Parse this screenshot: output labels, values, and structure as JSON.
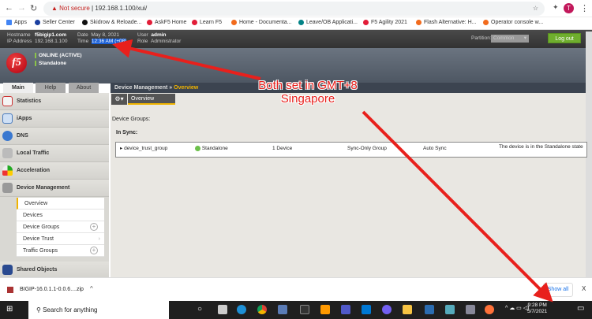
{
  "browser": {
    "security": "Not secure",
    "url": "192.168.1.100/xui/",
    "profile_initial": "T",
    "bookmarks": [
      "Apps",
      "Seller Center",
      "Skidrow & Reloade...",
      "AskF5 Home",
      "Learn F5",
      "Home - Documenta...",
      "Leave/OB Applicati...",
      "F5 Agility 2021",
      "Flash Alternative: H...",
      "Operator console w..."
    ]
  },
  "header": {
    "hostname_label": "Hostname",
    "hostname": "f5bigip1.com",
    "ip_label": "IP Address",
    "ip": "192.168.1.100",
    "date_label": "Date",
    "date": "May 8, 2021",
    "time_label": "Time",
    "time": "12:36 AM (+08)",
    "user_label": "User",
    "user": "admin",
    "role_label": "Role",
    "role": "Administrator",
    "partition_label": "Partition:",
    "partition": "Common",
    "logout": "Log out"
  },
  "status": {
    "online": "ONLINE (ACTIVE)",
    "mode": "Standalone",
    "logo": "f5"
  },
  "tabs": [
    "Main",
    "Help",
    "About"
  ],
  "breadcrumb": {
    "section": "Device Management",
    "sep": "»",
    "current": "Overview"
  },
  "subtab": "Overview",
  "sidebar": {
    "items": [
      "Statistics",
      "iApps",
      "DNS",
      "Local Traffic",
      "Acceleration",
      "Device Management"
    ],
    "subitems": [
      "Overview",
      "Devices",
      "Device Groups",
      "Device Trust",
      "Traffic Groups"
    ],
    "bottom": "Shared Objects"
  },
  "content": {
    "heading": "Device Groups:",
    "sync_label": "In Sync:",
    "row": {
      "name": "device_trust_group",
      "status": "Standalone",
      "devices": "1 Device",
      "type": "Sync-Only Group",
      "sync": "Auto Sync",
      "message": "The device is in the Standalone state"
    }
  },
  "annotation": "Both set in GMT+8 Singapore",
  "download": {
    "file": "BIGIP-16.0.1.1-0.0.6....zip",
    "show_all": "Show all"
  },
  "taskbar": {
    "search": "Search for anything",
    "time": "9:28 PM",
    "date": "5/7/2021"
  }
}
